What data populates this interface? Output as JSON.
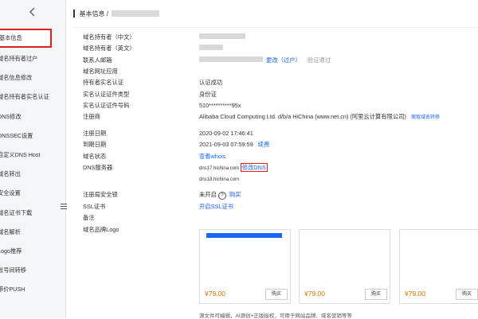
{
  "sidebar": {
    "items": [
      {
        "label": "基本信息",
        "active": true
      },
      {
        "label": "域名持有者过户"
      },
      {
        "label": "域名信息修改"
      },
      {
        "label": "域名持有者实名认证"
      },
      {
        "label": "DNS修改"
      },
      {
        "label": "DNSSEC设置"
      },
      {
        "label": "自定义DNS Host"
      },
      {
        "label": "域名转出"
      },
      {
        "label": "安全设置"
      },
      {
        "label": "域名证书下载"
      },
      {
        "label": "域名解析"
      },
      {
        "label": "Logo推荐"
      },
      {
        "label": "账号间转移"
      },
      {
        "label": "带价PUSH"
      }
    ]
  },
  "header": {
    "title": "基本信息 /"
  },
  "fields": {
    "owner_cn": "域名持有者（中文）",
    "owner_en": "域名持有者（英文）",
    "email": "联系人邮箱",
    "website_app": "域名网址应用",
    "realname": "持有者实名认证",
    "id_type": "实名认证证件类型",
    "id_number": "实名认证证件号码",
    "registrar": "注册商",
    "reg_date": "注册日期",
    "exp_date": "到期日期",
    "status": "域名状态",
    "dns": "DNS服务器",
    "reg_lock": "注册局安全锁",
    "ssl": "SSL证书",
    "remark": "备注",
    "logo": "域名品牌Logo"
  },
  "values": {
    "email_action": "更改（过户）",
    "email_verified": "验证通过",
    "realname": "认证成功",
    "id_type": "身份证",
    "id_number": "510**********95x",
    "registrar": "Alibaba Cloud Computing Ltd. d/b/a HiChina (www.net.cn) (阿里云计算有限公司)",
    "registrar_link": "案取域名转移",
    "reg_date": "2020-09-02 17:46:41",
    "exp_date": "2021-09-03 07:59:59",
    "renew": "续费",
    "status_link": "查看whois",
    "dns1": "dns17.hichina.com",
    "dns_modify": "修改DNS",
    "dns2": "dns18.hichina.com",
    "reg_lock": "未开启",
    "reg_lock_buy": "购买",
    "ssl_link": "开启SSL证书"
  },
  "cards": [
    {
      "price": "¥79.00",
      "buy": "购买"
    },
    {
      "price": "¥79.00",
      "buy": "购买"
    },
    {
      "price": "¥79.00",
      "buy": "购买"
    }
  ],
  "note": "源文件可编辑，AI源创+正版授权，可用于网站品牌、域名营销等等",
  "colors": {
    "accent": "#1a66ff",
    "highlight": "#e02020",
    "price": "#e07000"
  }
}
